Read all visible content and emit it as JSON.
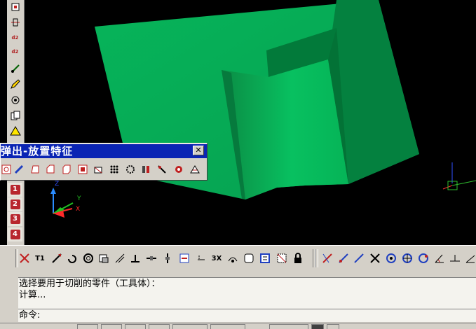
{
  "popup": {
    "title": "弹出-放置特征",
    "close_label": "✕"
  },
  "left_toolbar": {
    "numbered_buttons": [
      "1",
      "2",
      "3",
      "4"
    ]
  },
  "bottom_toolbar": {
    "text_button_t1": "T1",
    "text_button_3x": "3X"
  },
  "command": {
    "output_lines": [
      "选择要用于切削的零件（工具体）：",
      "计算..."
    ],
    "prompt": "命令:"
  },
  "axes": {
    "x": "X",
    "y": "Y",
    "z": "Z"
  },
  "colors": {
    "face_front": "#06a855",
    "face_top": "#00c060",
    "face_right": "#007a3c",
    "title_bar": "#0a24b4",
    "toolbar_bg": "#d4d0c8"
  }
}
